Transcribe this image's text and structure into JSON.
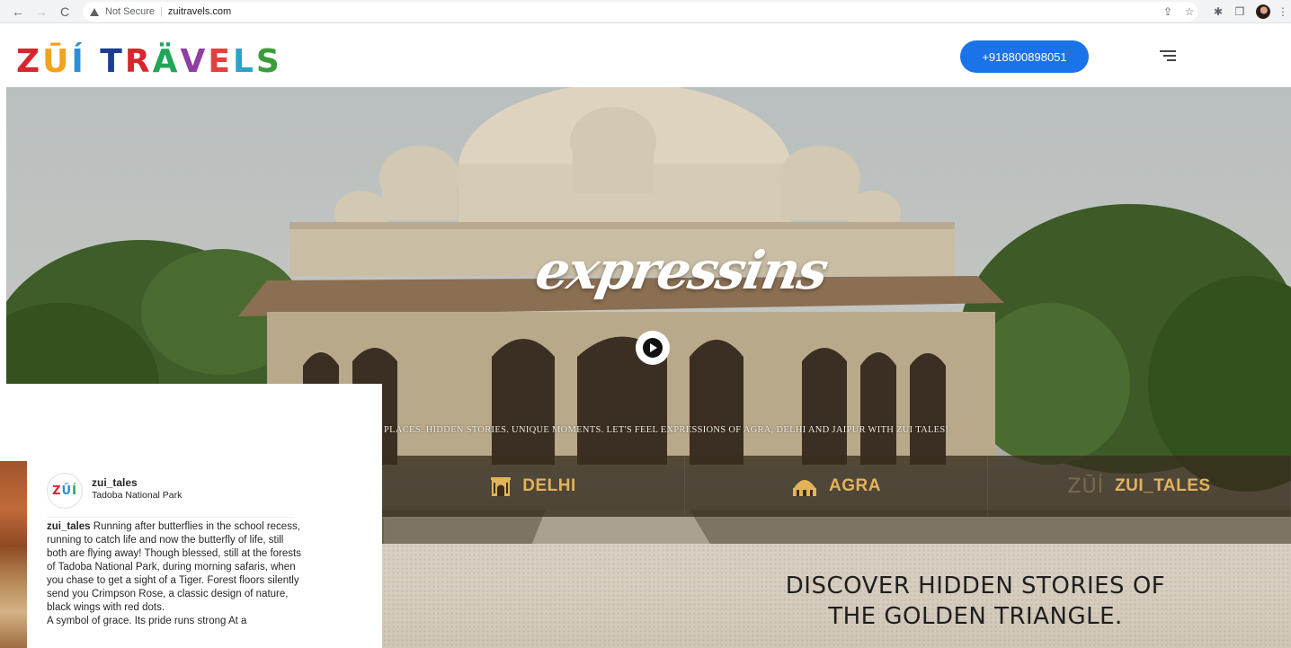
{
  "browser": {
    "security_label": "Not Secure",
    "url": "zuitravels.com",
    "back_icon": "←",
    "forward_icon": "→",
    "reload_icon": "C"
  },
  "header": {
    "logo_text": "ZŪÍ TRÄVELS",
    "logo_colors": [
      "#d7262d",
      "#f2a21b",
      "#2e8fd9",
      "#ffffff",
      "#1d3d8f",
      "#d7262d",
      "#21a559",
      "#8e3fa1",
      "#e83e3e",
      "#2aa3c9",
      "#3a9c3c"
    ],
    "phone_label": "+918800898051"
  },
  "hero": {
    "script_title": "expressins",
    "tagline": "PLACES. HIDDEN STORIES. UNIQUE MOMENTS. LET'S FEEL EXPRESSIONS OF AGRA, DELHI AND JAIPUR WITH ZUI TALES!",
    "cities": [
      {
        "label": "DELHI",
        "icon": "gate-icon"
      },
      {
        "label": "AGRA",
        "icon": "dome-icon"
      },
      {
        "label": "ZUI_TALES",
        "icon": "zui-logo-icon",
        "icon_text": "ZŪÍ"
      }
    ],
    "discover_title_line1": "DISCOVER HIDDEN STORIES OF",
    "discover_title_line2": "THE GOLDEN TRIANGLE."
  },
  "overlay_post": {
    "avatar_text": "ZŪÍ",
    "username": "zui_tales",
    "location": "Tadoba National Park",
    "caption_user": "zui_tales",
    "caption_text": " Running after butterflies in the school recess, running to catch life and now the butterfly of life, still both are flying away! Though blessed, still at the forests of Tadoba National Park, during morning safaris, when you chase to get a sight of a Tiger. Forest floors silently send you Crimpson Rose, a classic design of nature, black wings with red dots.",
    "caption_tail": "A symbol of grace. Its pride runs strong At a"
  },
  "colors": {
    "phone_button_bg": "#1a73e8",
    "city_label": "#e3b35a"
  }
}
